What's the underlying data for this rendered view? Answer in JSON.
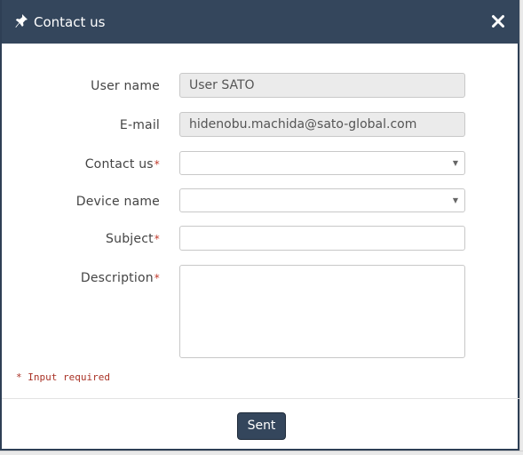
{
  "dialog": {
    "title": "Contact us",
    "icons": {
      "pin": "pushpin-icon",
      "close": "close-icon"
    }
  },
  "form": {
    "user_name": {
      "label": "User name",
      "value": "User SATO"
    },
    "email": {
      "label": "E-mail",
      "value": "hidenobu.machida@sato-global.com"
    },
    "contact_us": {
      "label": "Contact us",
      "required_mark": "*",
      "value": ""
    },
    "device_name": {
      "label": "Device name",
      "value": ""
    },
    "subject": {
      "label": "Subject",
      "required_mark": "*",
      "value": ""
    },
    "description": {
      "label": "Description",
      "required_mark": "*",
      "value": ""
    }
  },
  "note": "* Input required",
  "footer": {
    "sent_label": "Sent"
  },
  "colors": {
    "header": "#34465c",
    "required": "#c0392b",
    "readonly_bg": "#ebebeb"
  }
}
